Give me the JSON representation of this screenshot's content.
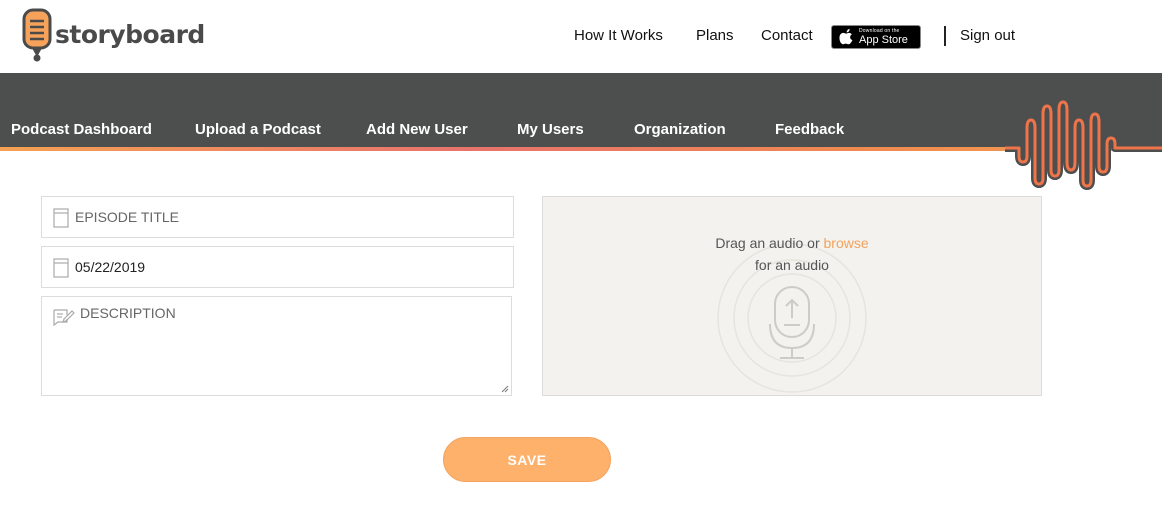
{
  "brand": {
    "name": "storyboard"
  },
  "top_nav": {
    "items": [
      {
        "label": "How It Works"
      },
      {
        "label": "Plans"
      },
      {
        "label": "Contact"
      }
    ],
    "app_store": {
      "line1": "Download on the",
      "line2": "App Store"
    },
    "sign_out": "Sign out"
  },
  "main_nav": {
    "items": [
      {
        "label": "Podcast Dashboard"
      },
      {
        "label": "Upload a Podcast"
      },
      {
        "label": "Add New User"
      },
      {
        "label": "My Users"
      },
      {
        "label": "Organization"
      },
      {
        "label": "Feedback"
      }
    ]
  },
  "form": {
    "title_placeholder": "EPISODE TITLE",
    "date_value": "05/22/2019",
    "description_placeholder": "DESCRIPTION",
    "save_label": "SAVE"
  },
  "upload": {
    "text_before": "Drag an audio or ",
    "browse_label": "browse",
    "text_after": "for an audio"
  },
  "colors": {
    "accent": "#f5a15a",
    "nav_bg": "#4d4e4e",
    "save_bg": "#fdb16b",
    "wave": "#f0744a"
  }
}
